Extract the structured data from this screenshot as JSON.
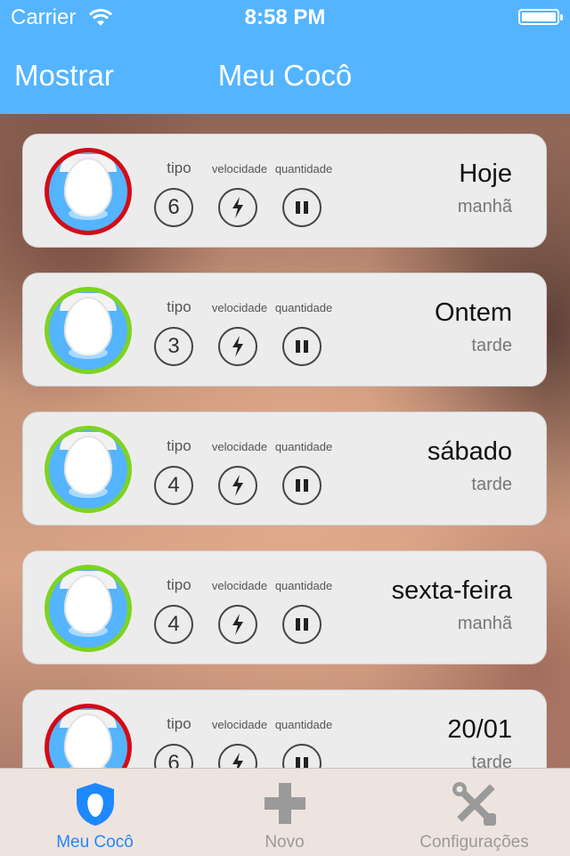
{
  "status": {
    "carrier": "Carrier",
    "time": "8:58 PM"
  },
  "nav": {
    "left_button": "Mostrar",
    "title": "Meu Cocô"
  },
  "labels": {
    "tipo": "tipo",
    "velocidade": "velocidade",
    "quantidade": "quantidade"
  },
  "entries": [
    {
      "tipo": "6",
      "day": "Hoje",
      "period": "manhã",
      "ring": "red"
    },
    {
      "tipo": "3",
      "day": "Ontem",
      "period": "tarde",
      "ring": "green"
    },
    {
      "tipo": "4",
      "day": "sábado",
      "period": "tarde",
      "ring": "green"
    },
    {
      "tipo": "4",
      "day": "sexta-feira",
      "period": "manhã",
      "ring": "green"
    },
    {
      "tipo": "6",
      "day": "20/01",
      "period": "tarde",
      "ring": "red"
    }
  ],
  "tabs": [
    {
      "label": "Meu Cocô",
      "icon": "shield-icon",
      "active": true
    },
    {
      "label": "Novo",
      "icon": "plus-icon",
      "active": false
    },
    {
      "label": "Configurações",
      "icon": "tools-icon",
      "active": false
    }
  ],
  "colors": {
    "accent": "#54b4ff",
    "ring_red": "#d50a15",
    "ring_green": "#7ed321",
    "tab_active": "#1e88ff"
  }
}
